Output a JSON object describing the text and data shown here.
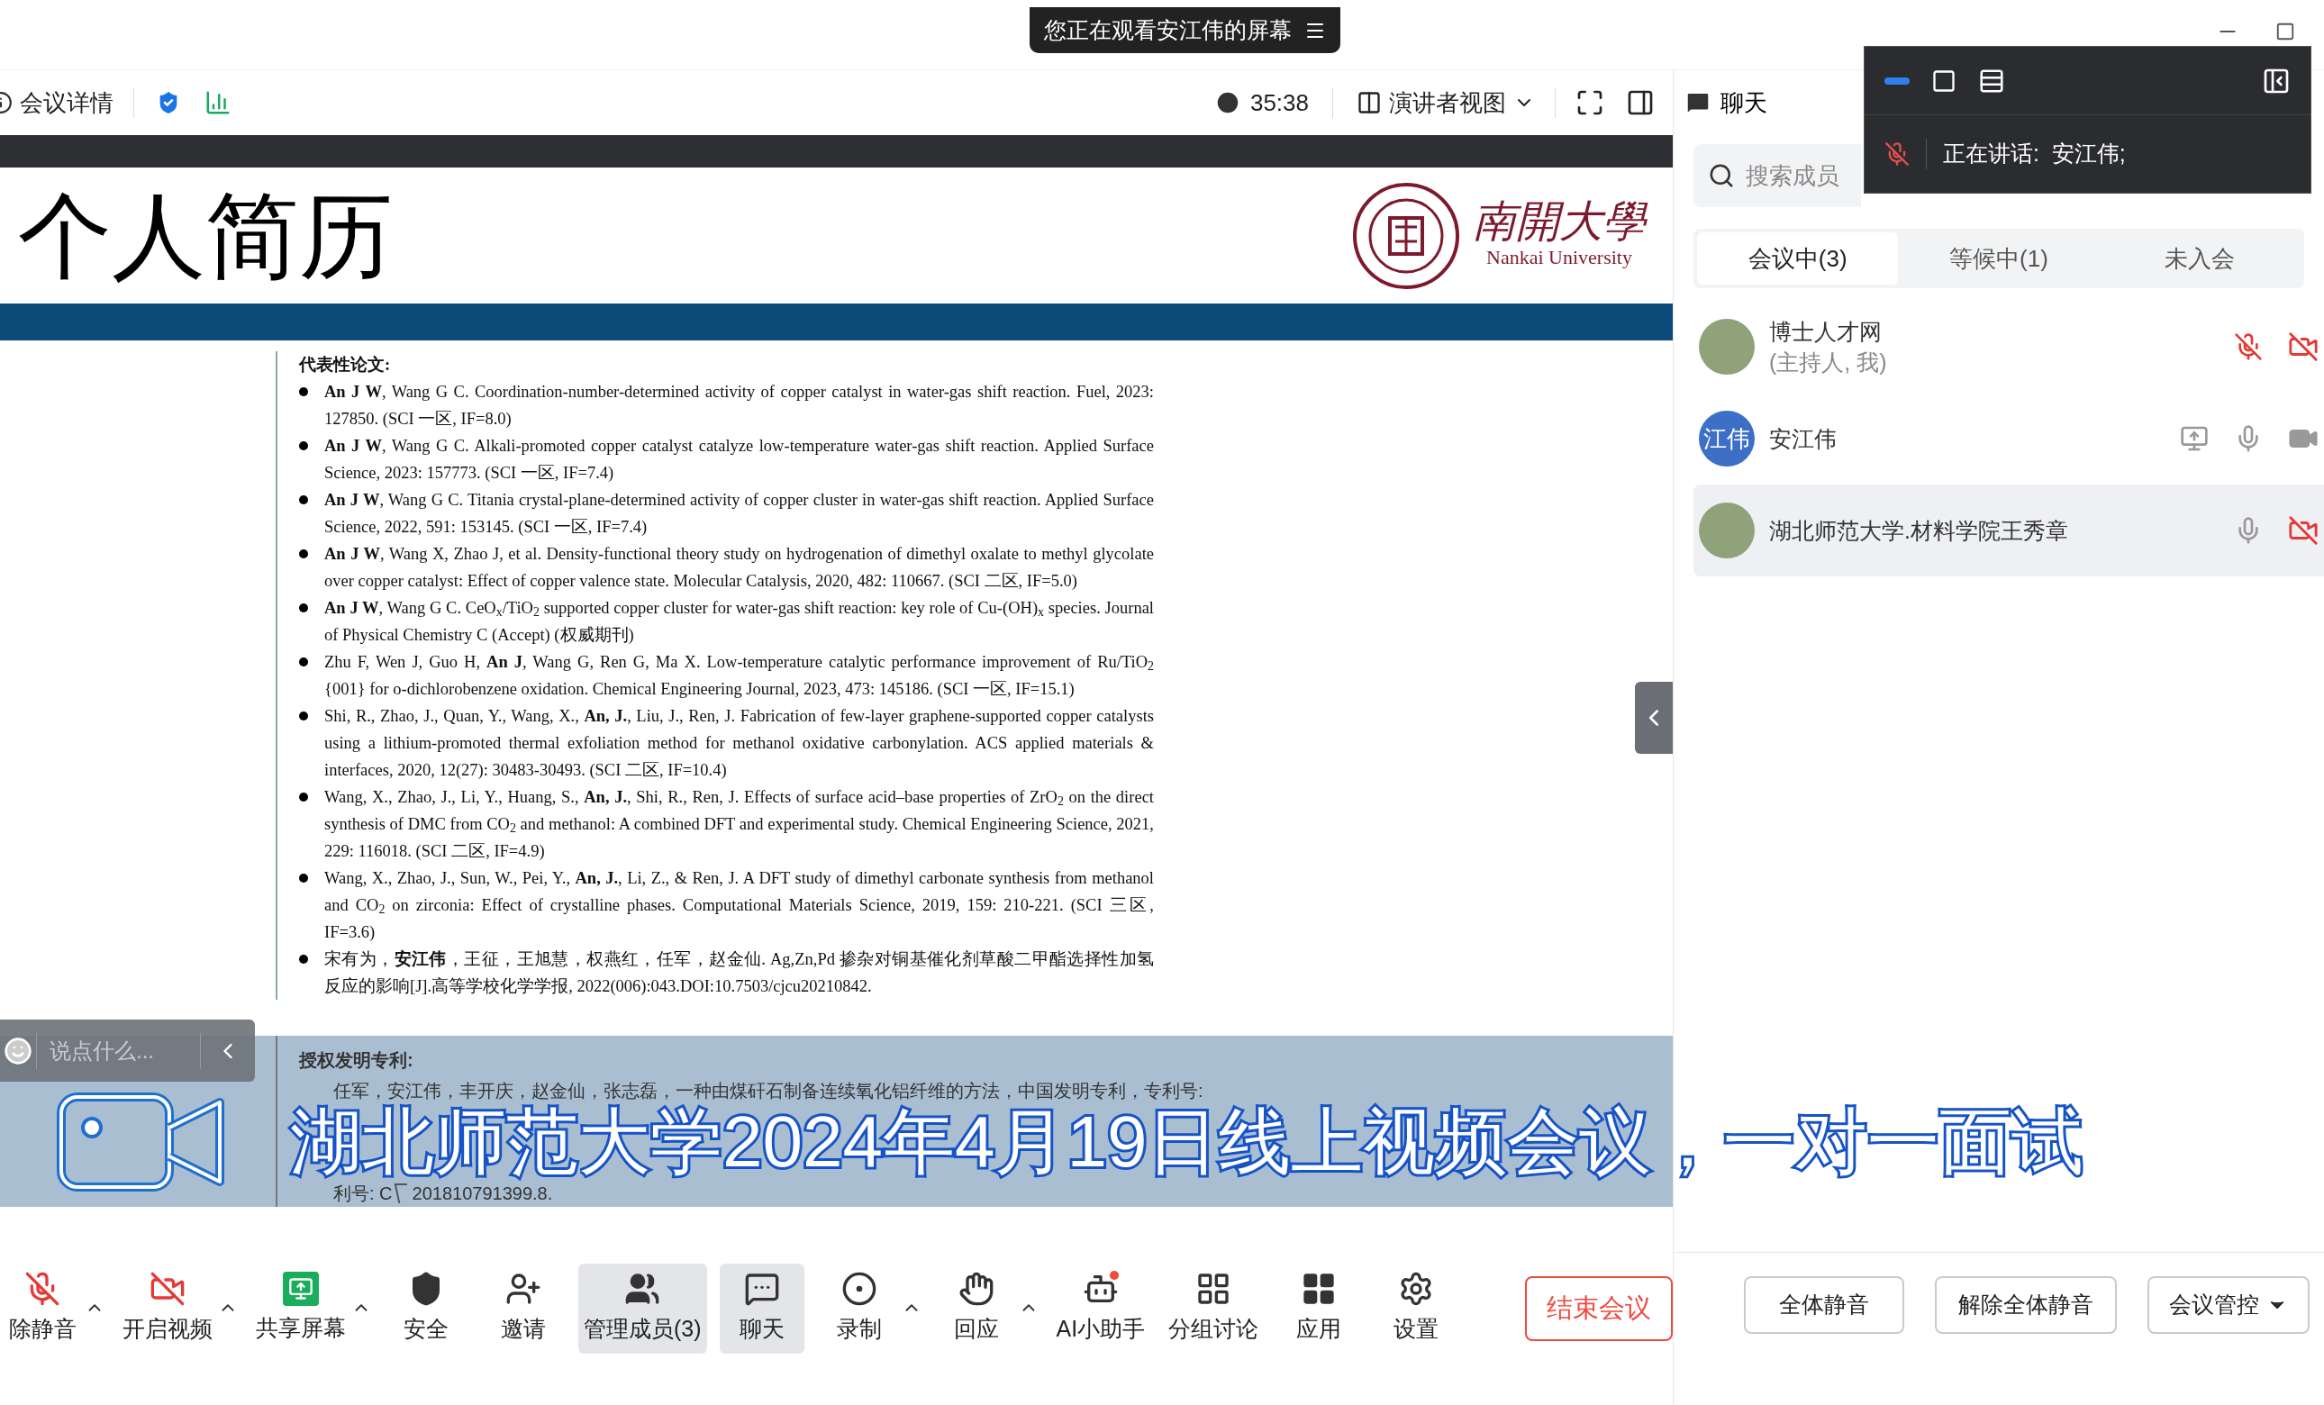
{
  "header": {
    "viewing_notice": "您正在观看安江伟的屏幕"
  },
  "toolbar": {
    "meeting_info": "会议详情",
    "timer": "35:38",
    "view": "演讲者视图"
  },
  "slide": {
    "title": "个人简历",
    "logo_name": "南開大學",
    "logo_subtitle": "Nankai University",
    "section": "代表性论文:",
    "papers": [
      "**An J W**, Wang G C. Coordination-number-determined activity of copper catalyst in water-gas shift reaction. Fuel, 2023: 127850. (SCI 一区, IF=8.0)",
      "**An J W**, Wang G C. Alkali-promoted copper catalyst catalyze low-temperature water-gas shift reaction. Applied Surface Science, 2023: 157773. (SCI 一区, IF=7.4)",
      "**An J W**, Wang G C. Titania crystal-plane-determined activity of copper cluster in water-gas shift reaction. Applied Surface Science, 2022, 591: 153145. (SCI 一区, IF=7.4)",
      "**An J W**, Wang X, Zhao J, et al. Density-functional theory study on hydrogenation of dimethyl oxalate to methyl glycolate over copper catalyst: Effect of copper valence state. Molecular Catalysis, 2020, 482: 110667. (SCI 二区, IF=5.0)",
      "**An J W**, Wang G C. CeO$_{x}$/TiO$_{2}$ supported copper cluster for water-gas shift reaction: key role of Cu-(OH)$_{x}$ species. Journal of Physical Chemistry C (Accept) (权威期刊)",
      "Zhu F, Wen J, Guo H, **An J**, Wang G, Ren G, Ma X. Low-temperature catalytic performance improvement of Ru/TiO$_{2}$ {001} for o-dichlorobenzene oxidation. Chemical Engineering Journal, 2023, 473: 145186. (SCI 一区, IF=15.1)",
      "Shi, R., Zhao, J., Quan, Y., Wang, X., **An, J.**, Liu, J., Ren, J. Fabrication of few-layer graphene-supported copper catalysts using a lithium-promoted thermal exfoliation method for methanol oxidative carbonylation. ACS applied materials & interfaces, 2020, 12(27): 30483-30493. (SCI 二区, IF=10.4)",
      "Wang, X., Zhao, J., Li, Y., Huang, S., **An, J.**, Shi, R., Ren, J. Effects of surface acid–base properties of ZrO$_{2}$ on the direct synthesis of DMC from CO$_{2}$ and methanol: A combined DFT and experimental study. Chemical Engineering Science, 2021, 229: 116018. (SCI 二区, IF=4.9)",
      "Wang, X., Zhao, J., Sun, W., Pei, Y., **An, J.**, Li, Z., & Ren, J. A DFT study of dimethyl carbonate synthesis from methanol and CO$_{2}$ on zirconia: Effect of crystalline phases. Computational Materials Science, 2019, 159: 210-221. (SCI 三区, IF=3.6)",
      "宋有为，**安江伟**，王征，王旭慧，权燕红，任军，赵金仙. Ag,Zn,Pd 掺杂对铜基催化剂草酸二甲酯选择性加氢反应的影响[J].高等学校化学学报, 2022(006):043.DOI:10.7503/cjcu20210842."
    ],
    "patent_section": "授权发明专利:",
    "patent_line_top": "任军，安江伟，丰开庆，赵金仙，张志磊，一种由煤矸石制备连续氧化铝纤维的方法，中国发明专利，专利号:",
    "patent_line_bottom_a": "利号: C",
    "patent_line_bottom_b": "201810791399.8."
  },
  "caption_banner": "湖北师范大学2024年4月19日线上视频会议，一对一面试",
  "chat_input": {
    "placeholder": "说点什么..."
  },
  "bottom_toolbar": [
    {
      "kind": "mic_off",
      "label": "除静音",
      "caret": true,
      "selected": false
    },
    {
      "kind": "video_off",
      "label": "开启视频",
      "caret": true,
      "selected": false
    },
    {
      "kind": "share",
      "label": "共享屏幕",
      "caret": true,
      "selected": false
    },
    {
      "kind": "shield",
      "label": "安全",
      "caret": false,
      "selected": false
    },
    {
      "kind": "invite",
      "label": "邀请",
      "caret": false,
      "selected": false
    },
    {
      "kind": "members",
      "label": "管理成员(3)",
      "caret": false,
      "selected": true
    },
    {
      "kind": "chat",
      "label": "聊天",
      "caret": false,
      "selected": true
    },
    {
      "kind": "record",
      "label": "录制",
      "caret": true,
      "selected": false
    },
    {
      "kind": "react",
      "label": "回应",
      "caret": true,
      "selected": false
    },
    {
      "kind": "assistant",
      "label": "AI小助手",
      "caret": false,
      "selected": false
    },
    {
      "kind": "breakout",
      "label": "分组讨论",
      "caret": false,
      "selected": false
    },
    {
      "kind": "apps",
      "label": "应用",
      "caret": false,
      "selected": false
    },
    {
      "kind": "settings",
      "label": "设置",
      "caret": false,
      "selected": false
    }
  ],
  "end_meeting": "结束会议",
  "side_panel": {
    "title": "聊天",
    "search": {
      "placeholder": "搜索成员"
    },
    "tabs": [
      {
        "label": "会议中(3)",
        "selected": true
      },
      {
        "label": "等候中(1)",
        "selected": false
      },
      {
        "label": "未入会",
        "selected": false
      }
    ],
    "members": [
      {
        "avatar": {
          "kind": "photo"
        },
        "name": "博士人才网",
        "role": "(主持人, 我)",
        "sharing": false,
        "mic_muted": true,
        "video_off": true,
        "selected": false
      },
      {
        "avatar": {
          "kind": "initials",
          "text": "江伟"
        },
        "name": "安江伟",
        "sharing": true,
        "mic_muted": false,
        "video_off": false,
        "selected": false
      },
      {
        "avatar": {
          "kind": "photo"
        },
        "name": "湖北师范大学.材料学院王秀章",
        "sharing": false,
        "mic_muted": false,
        "video_off": true,
        "selected": true
      }
    ],
    "buttons": [
      "全体静音",
      "解除全体静音"
    ],
    "control_menu": "会议管控"
  },
  "speaker_panel": {
    "speaking": "正在讲话:  安江伟;"
  }
}
